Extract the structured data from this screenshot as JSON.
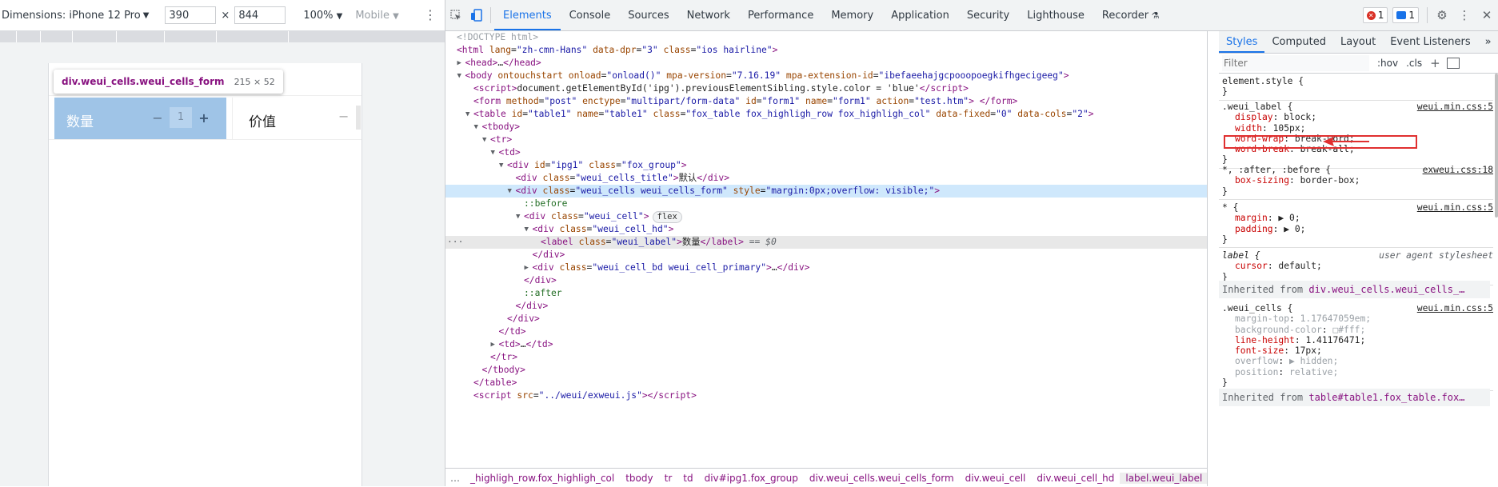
{
  "device_toolbar": {
    "dimensions_label": "Dimensions: iPhone 12 Pro",
    "width_value": "390",
    "height_value": "844",
    "times": "×",
    "zoom": "100%",
    "throttle": "Mobile",
    "caret": "▼"
  },
  "preview": {
    "tooltip_selector": "div.weui_cells.weui_cells_form",
    "tooltip_size": "215 × 52",
    "after_tooltip_text": "认",
    "cell1_label": "数量",
    "cell1_minus": "−",
    "cell1_value": "1",
    "cell1_plus": "+",
    "cell2_label": "价值",
    "cell2_minus": "−"
  },
  "devtools": {
    "tabs": [
      "Elements",
      "Console",
      "Sources",
      "Network",
      "Performance",
      "Memory",
      "Application",
      "Security",
      "Lighthouse",
      "Recorder"
    ],
    "error_count": "1",
    "message_count": "1"
  },
  "tree": [
    {
      "indent": 0,
      "html": "<span class='cm'>&lt;!DOCTYPE html&gt;</span>"
    },
    {
      "indent": 0,
      "html": "<span class='tag'>&lt;html</span> <span class='an'>lang</span>=<span class='av'>\"zh-cmn-Hans\"</span> <span class='an'>data-dpr</span>=<span class='av'>\"3\"</span> <span class='an'>class</span>=<span class='av'>\"ios hairline\"</span><span class='tag'>&gt;</span>"
    },
    {
      "indent": 1,
      "tri": "▶",
      "html": "<span class='tag'>&lt;head&gt;</span><span class='tx'>…</span><span class='tag'>&lt;/head&gt;</span>"
    },
    {
      "indent": 1,
      "tri": "▼",
      "html": "<span class='tag'>&lt;body</span> <span class='an'>ontouchstart</span> <span class='an'>onload</span>=<span class='av'>\"onload()\"</span> <span class='an'>mpa-version</span>=<span class='av'>\"7.16.19\"</span> <span class='an'>mpa-extension-id</span>=<span class='av'>\"ibefaeehajgcpooopoegkifhgecigeeg\"</span><span class='tag'>&gt;</span>"
    },
    {
      "indent": 2,
      "html": "<span class='tag'>&lt;script&gt;</span><span class='tx'>document.getElementById('ipg').previousElementSibling.style.color = 'blue'</span><span class='tag'>&lt;/script&gt;</span>"
    },
    {
      "indent": 2,
      "html": "<span class='tag'>&lt;form</span> <span class='an'>method</span>=<span class='av'>\"post\"</span> <span class='an'>enctype</span>=<span class='av'>\"multipart/form-data\"</span> <span class='an'>id</span>=<span class='av'>\"form1\"</span> <span class='an'>name</span>=<span class='av'>\"form1\"</span> <span class='an'>action</span>=<span class='av'>\"test.htm\"</span><span class='tag'>&gt;</span> <span class='tag'>&lt;/form&gt;</span>"
    },
    {
      "indent": 2,
      "tri": "▼",
      "html": "<span class='tag'>&lt;table</span> <span class='an'>id</span>=<span class='av'>\"table1\"</span> <span class='an'>name</span>=<span class='av'>\"table1\"</span> <span class='an'>class</span>=<span class='av'>\"fox_table fox_highligh_row fox_highligh_col\"</span> <span class='an'>data-fixed</span>=<span class='av'>\"0\"</span> <span class='an'>data-cols</span>=<span class='av'>\"2\"</span><span class='tag'>&gt;</span>"
    },
    {
      "indent": 3,
      "tri": "▼",
      "html": "<span class='tag'>&lt;tbody&gt;</span>"
    },
    {
      "indent": 4,
      "tri": "▼",
      "html": "<span class='tag'>&lt;tr&gt;</span>"
    },
    {
      "indent": 5,
      "tri": "▼",
      "html": "<span class='tag'>&lt;td&gt;</span>"
    },
    {
      "indent": 6,
      "tri": "▼",
      "html": "<span class='tag'>&lt;div</span> <span class='an'>id</span>=<span class='av'>\"ipg1\"</span> <span class='an'>class</span>=<span class='av'>\"fox_group\"</span><span class='tag'>&gt;</span>"
    },
    {
      "indent": 7,
      "html": "<span class='tag'>&lt;div</span> <span class='an'>class</span>=<span class='av'>\"weui_cells_title\"</span><span class='tag'>&gt;</span><span class='tx'>默认</span><span class='tag'>&lt;/div&gt;</span>"
    },
    {
      "indent": 7,
      "tri": "▼",
      "sel": true,
      "html": "<span class='tag'>&lt;div</span> <span class='an'>class</span>=<span class='av'>\"weui_cells weui_cells_form\"</span> <span class='an'>style</span>=<span class='av'>\"margin:0px;overflow: visible;\"</span><span class='tag'>&gt;</span>"
    },
    {
      "indent": 8,
      "html": "<span class='ps'>::before</span>"
    },
    {
      "indent": 8,
      "tri": "▼",
      "html": "<span class='tag'>&lt;div</span> <span class='an'>class</span>=<span class='av'>\"weui_cell\"</span><span class='tag'>&gt;</span><span class='flexbadge'>flex</span>"
    },
    {
      "indent": 9,
      "tri": "▼",
      "html": "<span class='tag'>&lt;div</span> <span class='an'>class</span>=<span class='av'>\"weui_cell_hd\"</span><span class='tag'>&gt;</span>"
    },
    {
      "indent": 10,
      "hover": true,
      "dots": "···",
      "html": "<span class='tag'>&lt;label</span> <span class='an'>class</span>=<span class='av'>\"weui_label\"</span><span class='tag'>&gt;</span><span class='tx'>数量</span><span class='tag'>&lt;/label&gt;</span> <span class='eq'>== $0</span>"
    },
    {
      "indent": 9,
      "html": "<span class='tag'>&lt;/div&gt;</span>"
    },
    {
      "indent": 9,
      "tri": "▶",
      "html": "<span class='tag'>&lt;div</span> <span class='an'>class</span>=<span class='av'>\"weui_cell_bd weui_cell_primary\"</span><span class='tag'>&gt;</span><span class='tx'>…</span><span class='tag'>&lt;/div&gt;</span>"
    },
    {
      "indent": 8,
      "html": "<span class='tag'>&lt;/div&gt;</span>"
    },
    {
      "indent": 8,
      "html": "<span class='ps'>::after</span>"
    },
    {
      "indent": 7,
      "html": "<span class='tag'>&lt;/div&gt;</span>"
    },
    {
      "indent": 6,
      "html": "<span class='tag'>&lt;/div&gt;</span>"
    },
    {
      "indent": 5,
      "html": "<span class='tag'>&lt;/td&gt;</span>"
    },
    {
      "indent": 5,
      "tri": "▶",
      "html": "<span class='tag'>&lt;td&gt;</span><span class='tx'>…</span><span class='tag'>&lt;/td&gt;</span>"
    },
    {
      "indent": 4,
      "html": "<span class='tag'>&lt;/tr&gt;</span>"
    },
    {
      "indent": 3,
      "html": "<span class='tag'>&lt;/tbody&gt;</span>"
    },
    {
      "indent": 2,
      "html": "<span class='tag'>&lt;/table&gt;</span>"
    },
    {
      "indent": 2,
      "html": "<span class='tag'>&lt;script</span> <span class='an'>src</span>=<span class='av'>\"../weui/exweui.js\"</span><span class='tag'>&gt;&lt;/script&gt;</span>"
    }
  ],
  "breadcrumbs": {
    "ellipsis": "…",
    "items": [
      "_highligh_row.fox_highligh_col",
      "tbody",
      "tr",
      "td",
      "div#ipg1.fox_group",
      "div.weui_cells.weui_cells_form",
      "div.weui_cell",
      "div.weui_cell_hd",
      "label.weui_label"
    ],
    "trailing": "…"
  },
  "styles": {
    "tabs": [
      "Styles",
      "Computed",
      "Layout",
      "Event Listeners"
    ],
    "more": "»",
    "filter_placeholder": "Filter",
    "hov": ":hov",
    "cls": ".cls",
    "plus": "+",
    "element_style_sel": "element.style {",
    "close_brace": "}",
    "rule1_sel": ".weui_label {",
    "rule1_src": "weui.min.css:5",
    "rule1_props": [
      {
        "n": "display",
        "v": "block;"
      },
      {
        "n": "width",
        "v": "105px;"
      },
      {
        "n": "word-wrap",
        "v": "break-word;"
      },
      {
        "n": "word-break",
        "v": "break-all;"
      }
    ],
    "rule2_sel": "*, :after, :before {",
    "rule2_src": "exweui.css:18",
    "rule2_props": [
      {
        "n": "box-sizing",
        "v": "border-box;"
      }
    ],
    "rule3_sel": "* {",
    "rule3_src": "weui.min.css:5",
    "rule3_props": [
      {
        "n": "margin",
        "v": "▶ 0;"
      },
      {
        "n": "padding",
        "v": "▶ 0;"
      }
    ],
    "rule4_sel": "label {",
    "rule4_src": "user agent stylesheet",
    "rule4_props": [
      {
        "n": "cursor",
        "v": "default;"
      }
    ],
    "inherited1_prefix": "Inherited from",
    "inherited1_sel": "div.weui_cells.weui_cells_…",
    "rule5_sel": ".weui_cells {",
    "rule5_src": "weui.min.css:5",
    "rule5_props": [
      {
        "n": "margin-top",
        "v": "1.17647059em;",
        "s": true
      },
      {
        "n": "background-color",
        "v": "□#fff;",
        "s": true
      },
      {
        "n": "line-height",
        "v": "1.41176471;"
      },
      {
        "n": "font-size",
        "v": "17px;"
      },
      {
        "n": "overflow",
        "v": "▶ hidden;",
        "s": true
      },
      {
        "n": "position",
        "v": "relative;",
        "s": true
      }
    ],
    "inherited2_prefix": "Inherited from",
    "inherited2_sel": "table#table1.fox_table.fox…"
  }
}
